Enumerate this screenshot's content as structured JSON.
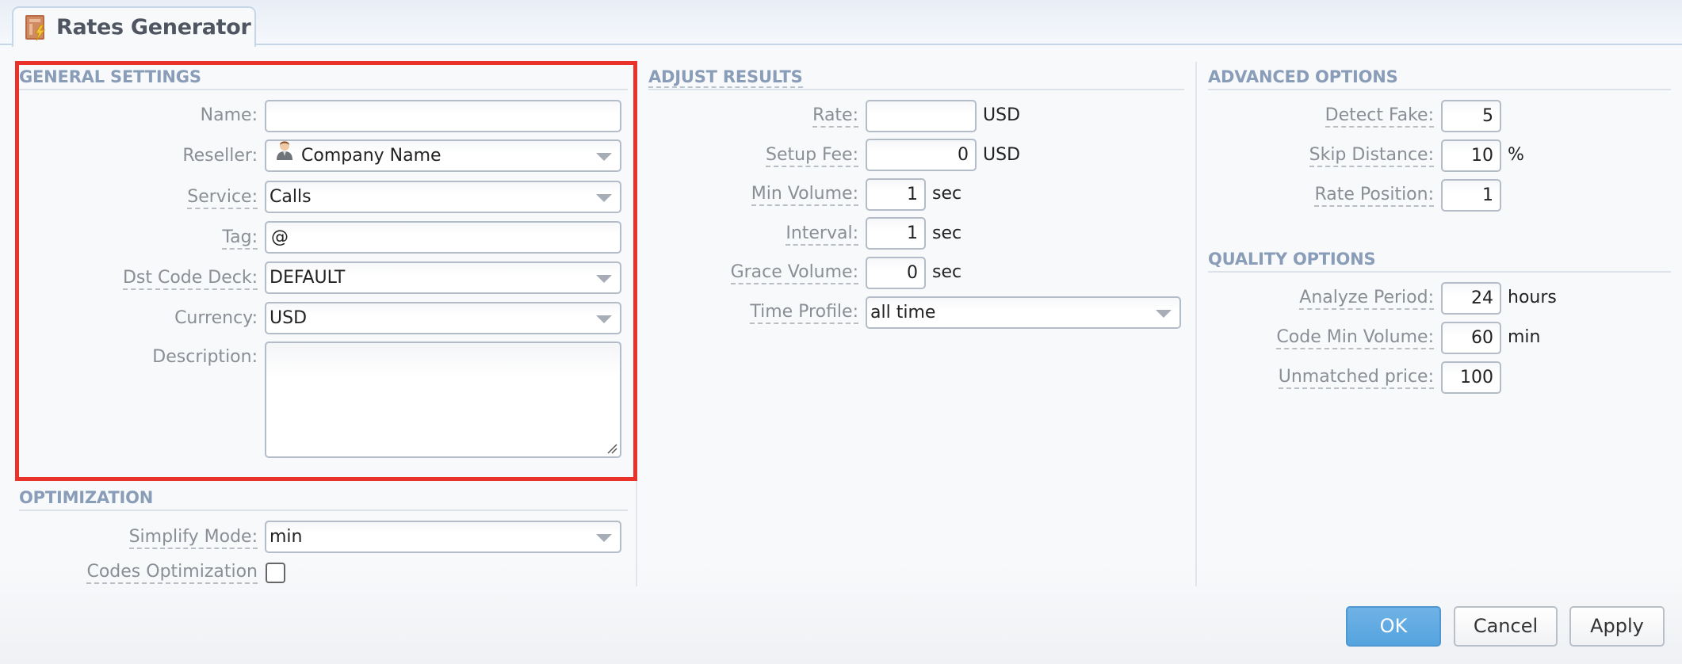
{
  "window": {
    "tab_title": "Rates Generator",
    "tab_icon": "rates-generator-icon"
  },
  "general_settings": {
    "title": "GENERAL SETTINGS",
    "name": {
      "label": "Name:",
      "value": ""
    },
    "reseller": {
      "label": "Reseller:",
      "value": "Company Name",
      "icon": "user-avatar-icon"
    },
    "service": {
      "label": "Service:",
      "value": "Calls"
    },
    "tag": {
      "label": "Tag:",
      "value": "@"
    },
    "dst_code_deck": {
      "label": "Dst Code Deck:",
      "value": "DEFAULT"
    },
    "currency": {
      "label": "Currency:",
      "value": "USD"
    },
    "description": {
      "label": "Description:",
      "value": ""
    }
  },
  "optimization": {
    "title": "OPTIMIZATION",
    "simplify_mode": {
      "label": "Simplify Mode:",
      "value": "min"
    },
    "codes_optimization": {
      "label": "Codes Optimization",
      "checked": false
    }
  },
  "adjust_results": {
    "title": "ADJUST RESULTS",
    "rate": {
      "label": "Rate:",
      "value": "",
      "unit": "USD"
    },
    "setup_fee": {
      "label": "Setup Fee:",
      "value": "0",
      "unit": "USD"
    },
    "min_volume": {
      "label": "Min Volume:",
      "value": "1",
      "unit": "sec"
    },
    "interval": {
      "label": "Interval:",
      "value": "1",
      "unit": "sec"
    },
    "grace_volume": {
      "label": "Grace Volume:",
      "value": "0",
      "unit": "sec"
    },
    "time_profile": {
      "label": "Time Profile:",
      "value": "all time"
    }
  },
  "advanced_options": {
    "title": "ADVANCED OPTIONS",
    "detect_fake": {
      "label": "Detect Fake:",
      "value": "5"
    },
    "skip_distance": {
      "label": "Skip Distance:",
      "value": "10",
      "unit": "%"
    },
    "rate_position": {
      "label": "Rate Position:",
      "value": "1"
    }
  },
  "quality_options": {
    "title": "QUALITY OPTIONS",
    "analyze_period": {
      "label": "Analyze Period:",
      "value": "24",
      "unit": "hours"
    },
    "code_min_volume": {
      "label": "Code Min Volume:",
      "value": "60",
      "unit": "min"
    },
    "unmatched_price": {
      "label": "Unmatched price:",
      "value": "100"
    }
  },
  "buttons": {
    "ok": "OK",
    "cancel": "Cancel",
    "apply": "Apply"
  },
  "colors": {
    "highlight_border": "#e8322a",
    "section_title": "#8a9db8",
    "primary_button": "#55a3df"
  }
}
